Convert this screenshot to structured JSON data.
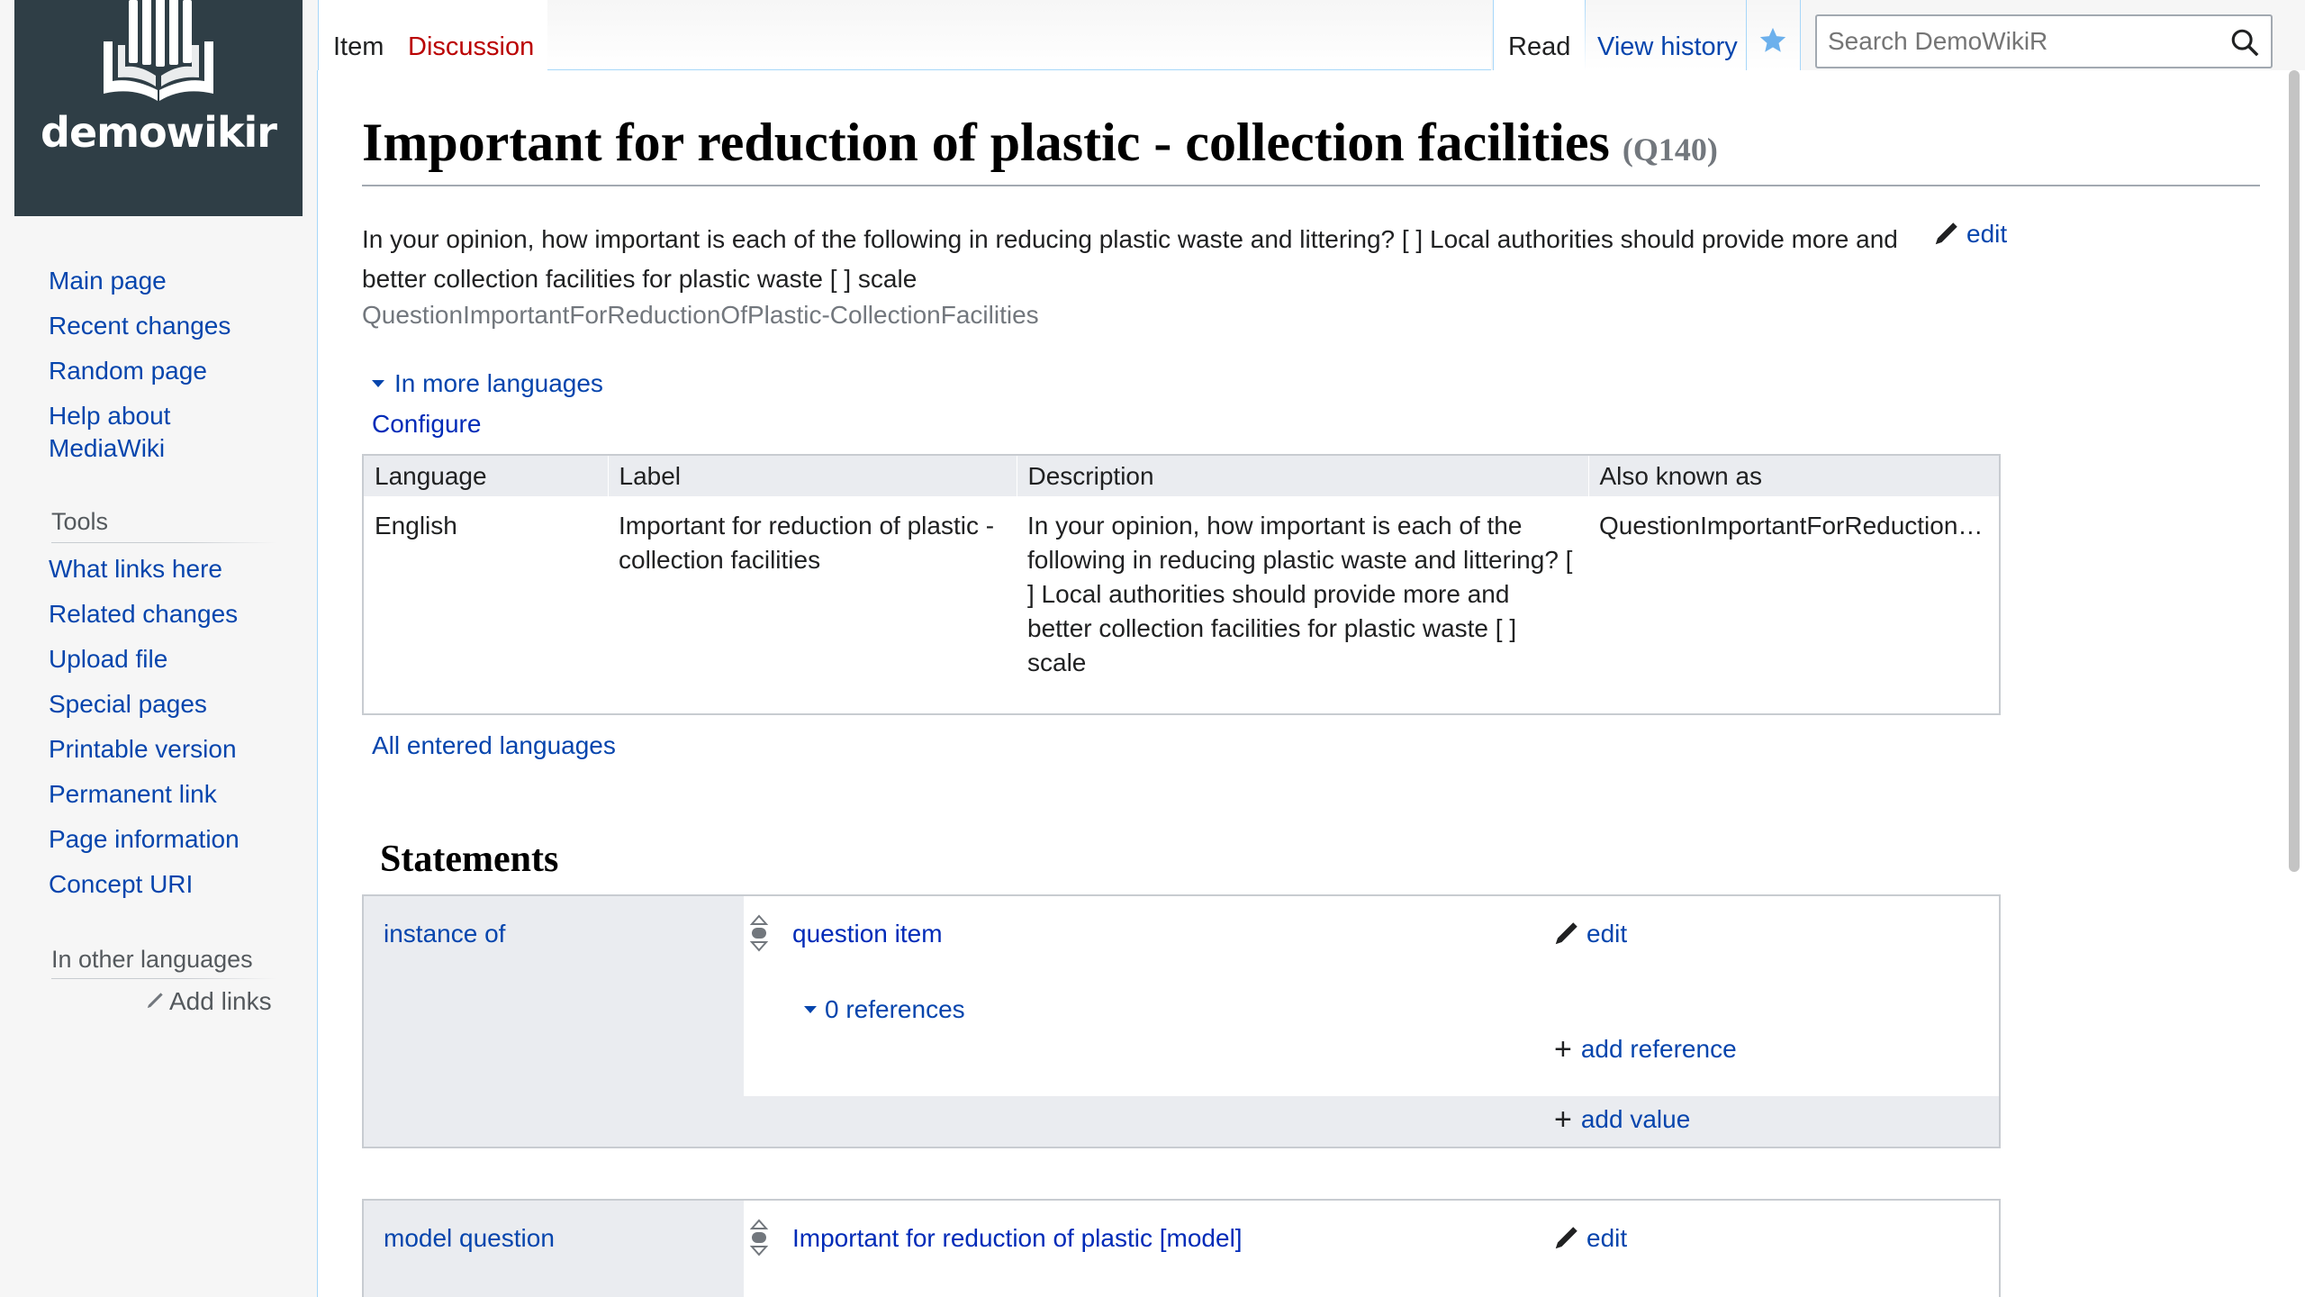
{
  "logo": {
    "text": "demowikir"
  },
  "nav": {
    "main_page": "Main page",
    "recent_changes": "Recent changes",
    "random_page": "Random page",
    "help_line1": "Help about",
    "help_line2": "MediaWiki"
  },
  "tools": {
    "heading": "Tools",
    "what_links_here": "What links here",
    "related_changes": "Related changes",
    "upload_file": "Upload file",
    "special_pages": "Special pages",
    "printable_version": "Printable version",
    "permanent_link": "Permanent link",
    "page_information": "Page information",
    "concept_uri": "Concept URI"
  },
  "other_languages": {
    "heading": "In other languages",
    "add_links": "Add links"
  },
  "tabs": {
    "item": "Item",
    "discussion": "Discussion",
    "read": "Read",
    "view_history": "View history"
  },
  "search": {
    "placeholder": "Search DemoWikiR"
  },
  "page": {
    "title": "Important for reduction of plastic - collection facilities",
    "qid": "(Q140)",
    "description": "In your opinion, how important is each of the following in reducing plastic waste and littering? [ ] Local authorities should provide more and better collection facilities for plastic waste [ ] scale",
    "description_edit": "edit",
    "alias": "QuestionImportantForReductionOfPlastic-CollectionFacilities"
  },
  "languages": {
    "toggle": "In more languages",
    "configure": "Configure",
    "headers": [
      "Language",
      "Label",
      "Description",
      "Also known as"
    ],
    "rows": [
      {
        "language": "English",
        "label": "Important for reduction of plastic - collection facilities",
        "description": "In your opinion, how important is each of the following in reducing plastic waste and littering? [ ] Local authorities should provide more and better collection facilities for plastic waste [ ] scale",
        "aliases": "QuestionImportantForReduction…"
      }
    ],
    "all_entered": "All entered languages"
  },
  "statements": {
    "heading": "Statements",
    "groups": [
      {
        "property": "instance of",
        "value": "question item",
        "edit": "edit",
        "references": "0 references",
        "add_reference": "add reference",
        "add_value": "add value"
      },
      {
        "property": "model question",
        "value": "Important for reduction of plastic [model]",
        "edit": "edit"
      }
    ]
  },
  "colors": {
    "link": "#0645ad",
    "dark_link": "#002bb8",
    "red_link": "#ba0000",
    "logo_bg": "#2f3e46",
    "tab_border": "#a7d7f9",
    "table_header_bg": "#eaecf0"
  }
}
